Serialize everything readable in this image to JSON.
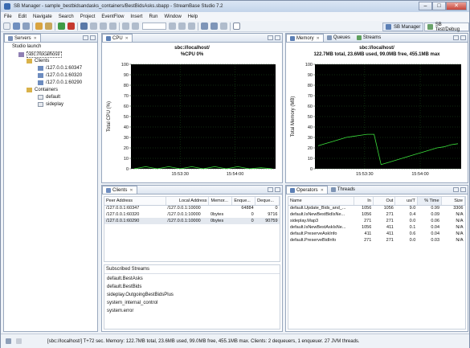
{
  "window": {
    "title": "SB Manager - sample_bestbidsandasks_containers/BestBidsAsks.sbapp - StreamBase Studio 7.2"
  },
  "menu": [
    "File",
    "Edit",
    "Navigate",
    "Search",
    "Project",
    "EventFlow",
    "Insert",
    "Run",
    "Window",
    "Help"
  ],
  "perspectives": {
    "sb_manager": "SB Manager",
    "sb_test": "SB Test/Debug"
  },
  "servers": {
    "tab": "Servers",
    "root": "Studio launch",
    "server": "sbc://localhost/",
    "clients_label": "Clients",
    "clients": [
      "/127.0.0.1:60347",
      "/127.0.0.1:60320",
      "/127.0.0.1:60290"
    ],
    "containers_label": "Containers",
    "containers": [
      "default",
      "sideplay"
    ]
  },
  "cpu": {
    "tab": "CPU",
    "title1": "sbc://localhost/",
    "title2": "%CPU 0%",
    "ylabel": "Total CPU (%)",
    "ytick_labels": [
      "100",
      "90",
      "80",
      "70",
      "60",
      "50",
      "40",
      "30",
      "20",
      "10",
      "0"
    ],
    "xtick_labels": [
      "15:53:30",
      "15:54:00"
    ]
  },
  "memory": {
    "tabs": [
      "Memory",
      "Queues",
      "Streams"
    ],
    "title1": "sbc://localhost/",
    "title2": "122.7MB total, 23.6MB used, 99.0MB free, 455.1MB max",
    "ylabel": "Total Memory (MB)",
    "ytick_labels": [
      "100",
      "90",
      "80",
      "70",
      "60",
      "50",
      "40",
      "30",
      "20",
      "10",
      "0"
    ],
    "xtick_labels": [
      "15:53:30",
      "15:54:00"
    ]
  },
  "clients": {
    "tab": "Clients",
    "columns": [
      "Peer Address",
      "Local Address",
      "Memor...",
      "Enque...",
      "Deque..."
    ],
    "rows": [
      [
        "/127.0.0.1:60347",
        "/127.0.0.1:10000",
        "",
        "64884",
        "0"
      ],
      [
        "/127.0.0.1:60320",
        "/127.0.0.1:10000",
        "0bytes",
        "0",
        "9716"
      ],
      [
        "/127.0.0.1:60290",
        "/127.0.0.1:10000",
        "0bytes",
        "0",
        "90759"
      ]
    ],
    "streams_header": "Subscribed Streams",
    "streams": [
      "default.BestAsks",
      "default.BestBids",
      "sideplay.OutgoingBestBidsPlus",
      "system_internal_control",
      "system.error"
    ]
  },
  "operators": {
    "tabs": [
      "Operators",
      "Threads"
    ],
    "columns": [
      "Name",
      "In",
      "Out",
      "us/T",
      "% Time",
      "Size"
    ],
    "rows": [
      [
        "default.Update_Bids_and_...",
        "1056",
        "1056",
        "9.0",
        "0.99",
        "3306"
      ],
      [
        "default.IsNewBestBidIsNe...",
        "1056",
        "271",
        "0.4",
        "0.09",
        "N/A"
      ],
      [
        "sideplay.Map3",
        "271",
        "271",
        "0.0",
        "0.06",
        "N/A"
      ],
      [
        "default.IsNewBestAskIsNe...",
        "1056",
        "411",
        "0.1",
        "0.04",
        "N/A"
      ],
      [
        "default.PreserveAskInfo",
        "411",
        "411",
        "0.6",
        "0.04",
        "N/A"
      ],
      [
        "default.PreserveBidInfo",
        "271",
        "271",
        "0.0",
        "0.03",
        "N/A"
      ]
    ]
  },
  "status": "[sbc://localhost/] T+72 sec. Memory: 122.7MB total, 23.6MB used, 99.0MB free, 455.1MB max.  Clients: 2 dequeuers, 1 enqueuer.  27 JVM threads.",
  "colors": {
    "plot_bg": "#000000",
    "line": "#3be03b",
    "grid": "#1e5a1e"
  },
  "chart_data": [
    {
      "type": "line",
      "title": "sbc://localhost/ %CPU 0%",
      "ylabel": "Total CPU (%)",
      "ylim": [
        0,
        100
      ],
      "x": [
        "15:53:30",
        "15:54:00"
      ],
      "series": [
        {
          "values": [
            0,
            2,
            0,
            2,
            0,
            2,
            0,
            2,
            0,
            2,
            0,
            1,
            0
          ]
        }
      ]
    },
    {
      "type": "line",
      "title": "sbc://localhost/ 122.7MB total, 23.6MB used, 99.0MB free, 455.1MB max",
      "ylabel": "Total Memory (MB)",
      "ylim": [
        0,
        100
      ],
      "x": [
        "15:53:30",
        "15:54:00"
      ],
      "series": [
        {
          "values": [
            22,
            24,
            26,
            28,
            30,
            31,
            32,
            33,
            33,
            4,
            6,
            8,
            10,
            12,
            14,
            16,
            18,
            20,
            21,
            23,
            24
          ]
        }
      ]
    }
  ]
}
